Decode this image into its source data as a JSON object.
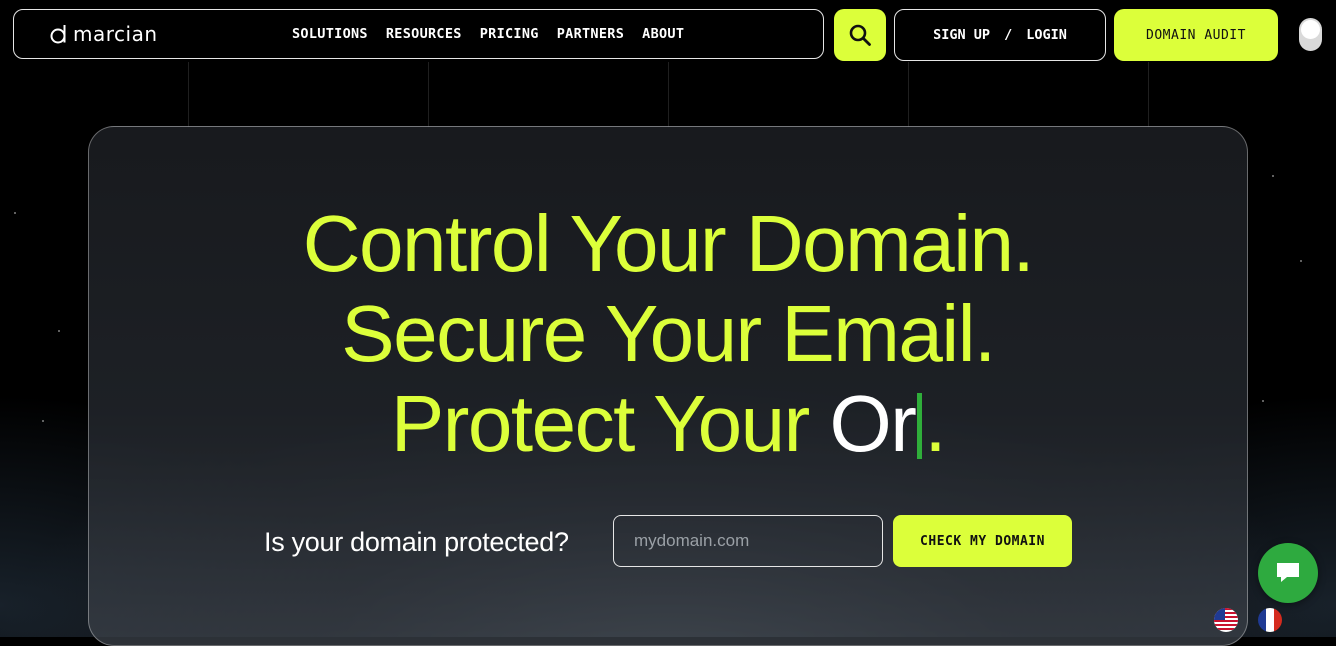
{
  "header": {
    "logo_text": "marcian",
    "nav": [
      {
        "label": "SOLUTIONS"
      },
      {
        "label": "RESOURCES"
      },
      {
        "label": "PRICING"
      },
      {
        "label": "PARTNERS"
      },
      {
        "label": "ABOUT"
      }
    ],
    "search_icon": "search-icon",
    "signup_label": "SIGN UP",
    "separator": "/",
    "login_label": "LOGIN",
    "audit_label": "DOMAIN AUDIT"
  },
  "hero": {
    "line1": "Control Your Domain.",
    "line2": "Secure Your Email.",
    "line3_prefix": "Protect Your ",
    "line3_typed": "Or",
    "line3_suffix": ".",
    "prompt": "Is your domain protected?",
    "input_placeholder": "mydomain.com",
    "input_value": "",
    "check_label": "CHECK MY DOMAIN"
  },
  "widgets": {
    "chat_icon": "chat-icon",
    "languages": [
      {
        "name": "us-flag-icon"
      },
      {
        "name": "fr-flag-icon"
      }
    ]
  },
  "colors": {
    "accent": "#dcff3a",
    "background": "#000000",
    "chat": "#2eaa3f",
    "caret": "#2fae3a"
  }
}
